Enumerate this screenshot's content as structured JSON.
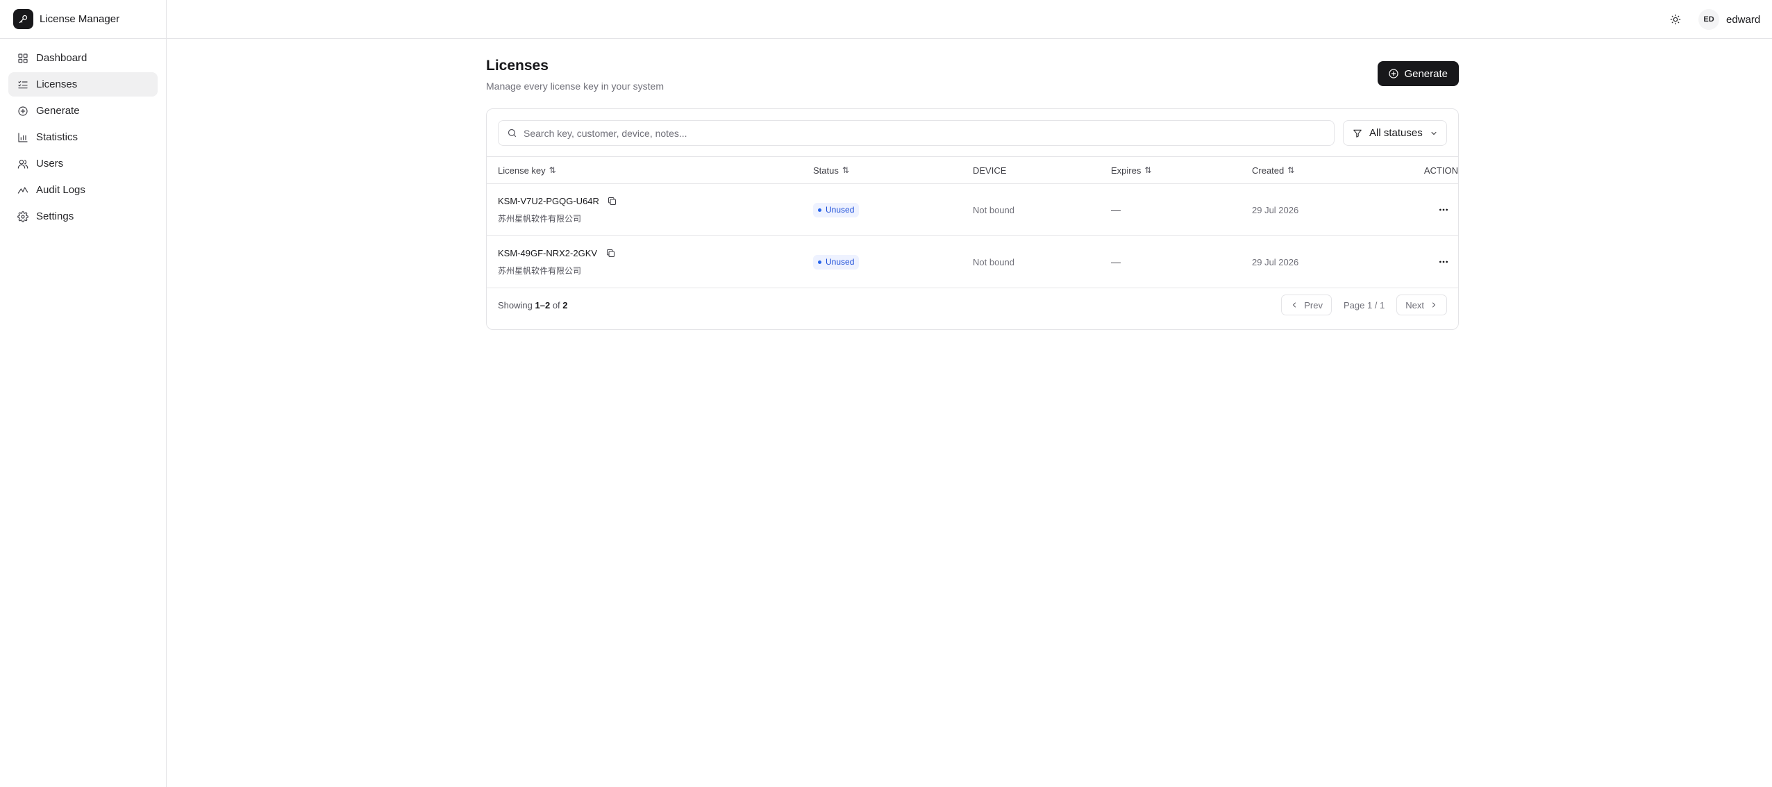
{
  "app": {
    "name": "License Manager"
  },
  "sidebar": {
    "items": [
      {
        "label": "Dashboard",
        "icon": "grid-icon",
        "active": false
      },
      {
        "label": "Licenses",
        "icon": "list-checks-icon",
        "active": true
      },
      {
        "label": "Generate",
        "icon": "plus-circle-icon",
        "active": false
      },
      {
        "label": "Statistics",
        "icon": "bar-chart-icon",
        "active": false
      },
      {
        "label": "Users",
        "icon": "users-icon",
        "active": false
      },
      {
        "label": "Audit Logs",
        "icon": "activity-icon",
        "active": false
      },
      {
        "label": "Settings",
        "icon": "gear-icon",
        "active": false
      }
    ]
  },
  "header": {
    "theme_icon": "sun-icon",
    "user": {
      "initials": "ED",
      "name": "edward"
    }
  },
  "page": {
    "title": "Licenses",
    "subtitle": "Manage every license key in your system",
    "generate_label": "Generate"
  },
  "search": {
    "placeholder": "Search key, customer, device, notes...",
    "value": ""
  },
  "filter": {
    "status_label": "All statuses"
  },
  "table": {
    "headers": {
      "license_key": "License key",
      "status": "Status",
      "device": "DEVICE",
      "expires": "Expires",
      "created": "Created",
      "action": "ACTION"
    },
    "sort_glyph": "⇅",
    "rows": [
      {
        "key": "KSM-V7U2-PGQG-U64R",
        "customer": "苏州星帆软件有限公司",
        "status": "Unused",
        "device": "Not bound",
        "expires": "—",
        "created": "29 Jul 2026"
      },
      {
        "key": "KSM-49GF-NRX2-2GKV",
        "customer": "苏州星帆软件有限公司",
        "status": "Unused",
        "device": "Not bound",
        "expires": "—",
        "created": "29 Jul 2026"
      }
    ]
  },
  "pagination": {
    "showing_prefix": "Showing",
    "range": "1–2",
    "of_word": "of",
    "total": "2",
    "prev_label": "Prev",
    "next_label": "Next",
    "page_info": "Page 1 / 1"
  },
  "colors": {
    "accent": "#18181b",
    "badge_bg": "#eef2ff",
    "badge_text": "#1d4ed8",
    "border": "#e4e4e7"
  }
}
